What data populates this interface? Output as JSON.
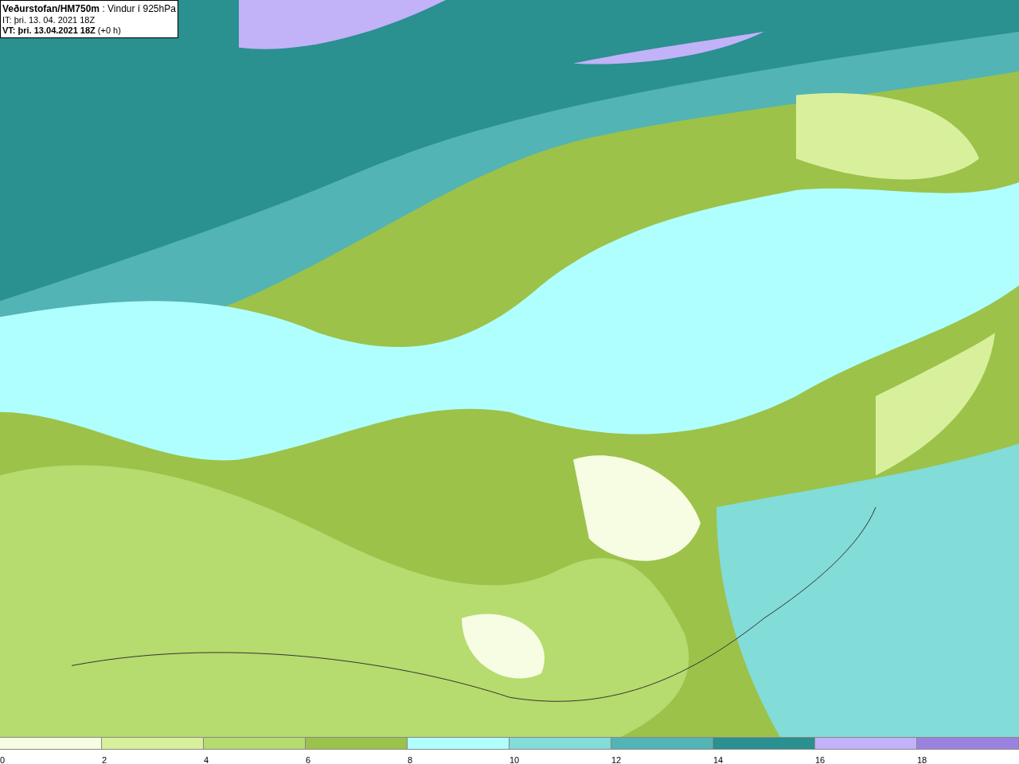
{
  "header": {
    "lines": [
      "**Veðurstofan/HM750m** : Vindur í 925hPa",
      "IT: þri. 13. 04. 2021 18Z",
      "**VT: þri. 13.04.2021 18Z** (+0 h)"
    ]
  },
  "legend": {
    "bins": [
      {
        "color": "#f6fde2"
      },
      {
        "color": "#d8f09c"
      },
      {
        "color": "#b6db6e"
      },
      {
        "color": "#9bc24a"
      },
      {
        "color": "#b0ffff"
      },
      {
        "color": "#82dcd8"
      },
      {
        "color": "#52b4b4"
      },
      {
        "color": "#2a9090"
      },
      {
        "color": "#c2b2f8"
      },
      {
        "color": "#9c82e0"
      }
    ],
    "labels": [
      "0",
      "2",
      "4",
      "6",
      "8",
      "10",
      "12",
      "14",
      "16",
      "18"
    ]
  }
}
